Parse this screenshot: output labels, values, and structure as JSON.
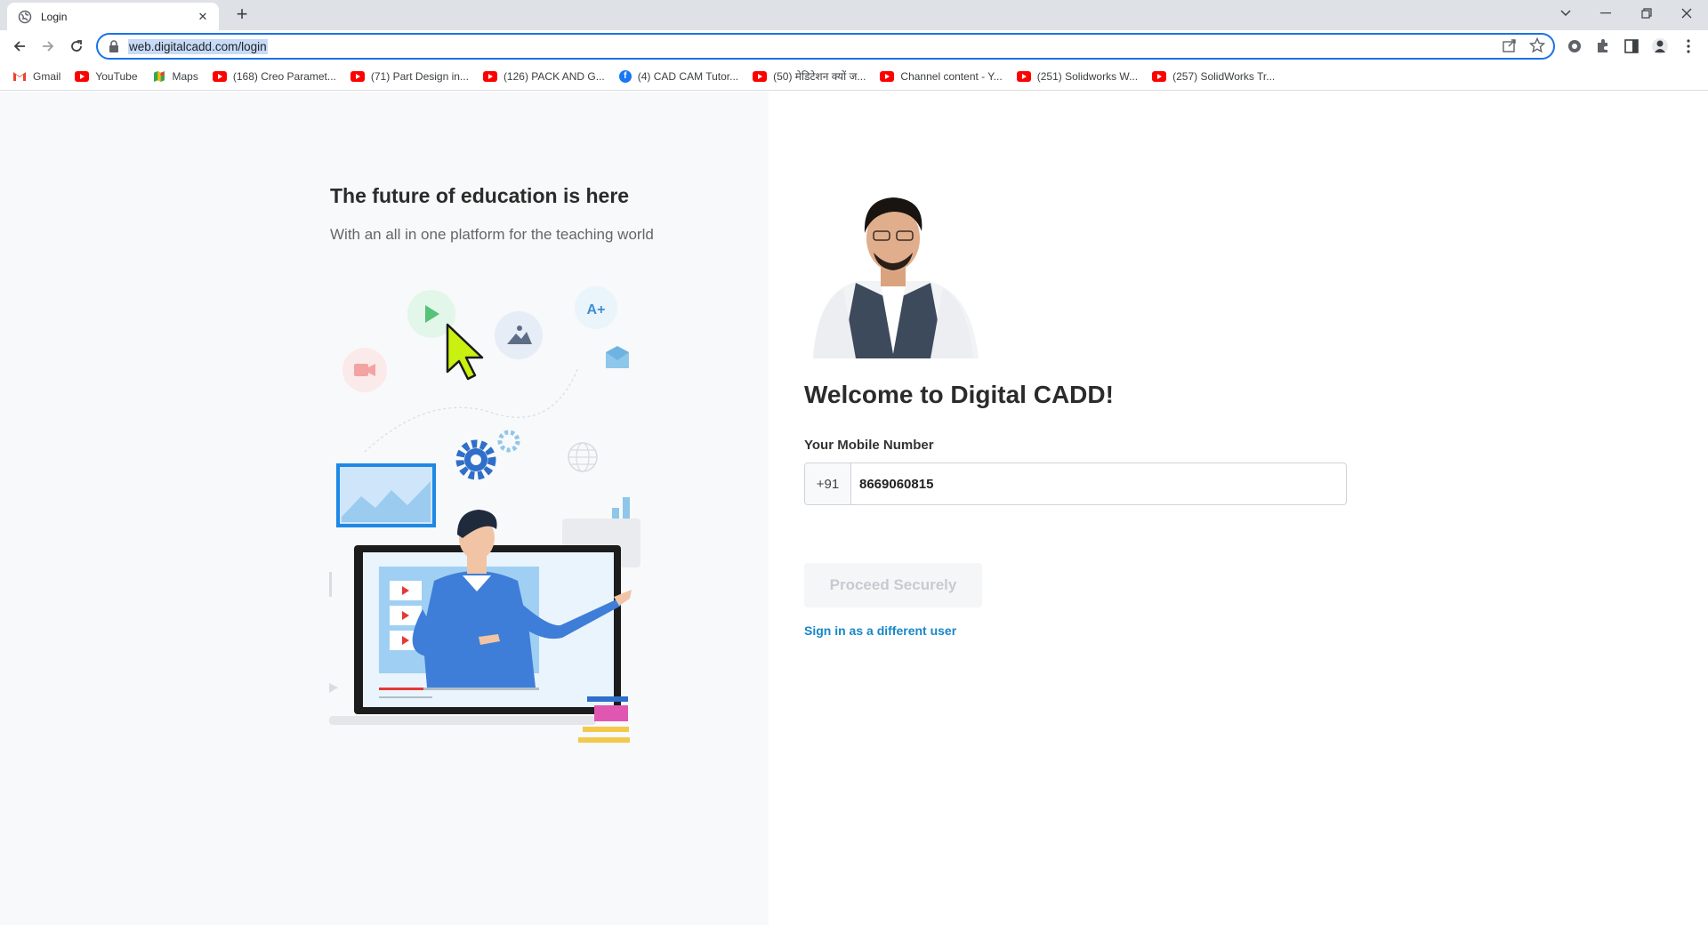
{
  "browser": {
    "tab_title": "Login",
    "new_tab_symbol": "+",
    "url": "web.digitalcadd.com/login",
    "bookmarks": [
      {
        "label": "Gmail",
        "icon": "gmail-icon"
      },
      {
        "label": "YouTube",
        "icon": "youtube-icon"
      },
      {
        "label": "Maps",
        "icon": "maps-icon"
      },
      {
        "label": "(168) Creo Paramet...",
        "icon": "youtube-icon"
      },
      {
        "label": "(71) Part Design in...",
        "icon": "youtube-icon"
      },
      {
        "label": "(126) PACK AND G...",
        "icon": "youtube-icon"
      },
      {
        "label": "(4) CAD CAM Tutor...",
        "icon": "facebook-icon"
      },
      {
        "label": "(50) मेडिटेशन क्यों ज...",
        "icon": "youtube-icon"
      },
      {
        "label": "Channel content - Y...",
        "icon": "youtube-icon"
      },
      {
        "label": "(251) Solidworks W...",
        "icon": "youtube-icon"
      },
      {
        "label": "(257) SolidWorks Tr...",
        "icon": "youtube-icon"
      }
    ]
  },
  "hero": {
    "title": "The future of education is here",
    "subtitle": "With an all in one platform for the teaching world",
    "badge_text": "A+"
  },
  "login": {
    "welcome": "Welcome to Digital CADD!",
    "mobile_label": "Your Mobile Number",
    "country_code": "+91",
    "mobile_value": "8669060815",
    "proceed_label": "Proceed Securely",
    "different_user_label": "Sign in as a different user"
  },
  "colors": {
    "accent_link": "#1787c8",
    "omnibox_border": "#1a73e8",
    "left_panel_bg": "#f8f9fa"
  }
}
